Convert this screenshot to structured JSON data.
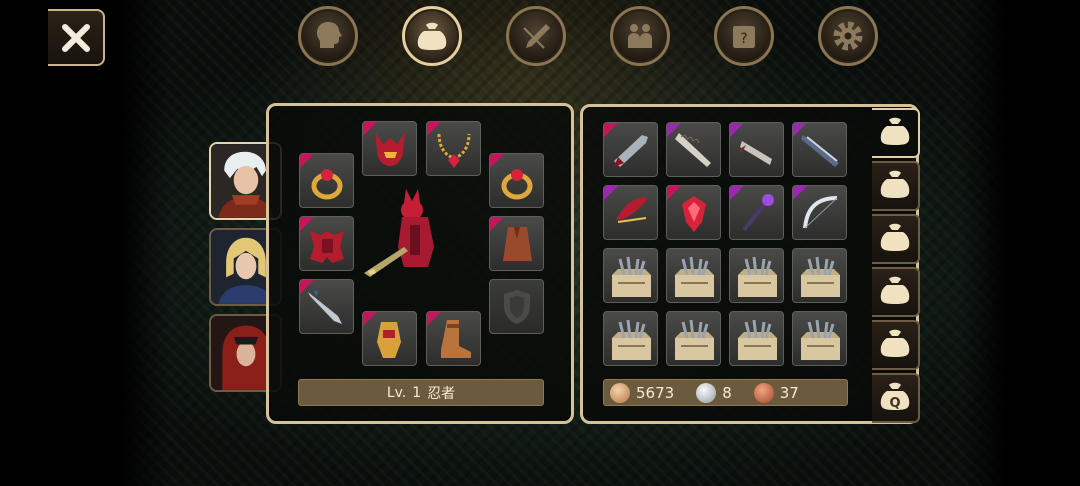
{
  "topnav": {
    "items": [
      {
        "name": "character",
        "icon": "head-silhouette-icon",
        "active": false
      },
      {
        "name": "inventory",
        "icon": "bag-icon",
        "active": true
      },
      {
        "name": "skills",
        "icon": "crossed-sword-icon",
        "active": false
      },
      {
        "name": "party",
        "icon": "party-people-icon",
        "active": false
      },
      {
        "name": "quests",
        "icon": "quest-scroll-icon",
        "active": false
      },
      {
        "name": "settings",
        "icon": "gear-icon",
        "active": false
      }
    ]
  },
  "characters": [
    {
      "portrait": "white-haired-ninja",
      "selected": true
    },
    {
      "portrait": "blonde-elf-knight",
      "selected": false
    },
    {
      "portrait": "red-haired-mage",
      "selected": false
    }
  ],
  "equipment": {
    "level_prefix": "Lv.",
    "level": "1",
    "class_name": "忍者",
    "slots": [
      {
        "slot": "helmet",
        "item": "red-dragon-helm",
        "rarity": "red"
      },
      {
        "slot": "necklace",
        "item": "gold-ruby-necklace",
        "rarity": "red"
      },
      {
        "slot": "ring-left",
        "item": "gold-ring",
        "rarity": "red"
      },
      {
        "slot": "ring-right",
        "item": "gold-ring",
        "rarity": "red"
      },
      {
        "slot": "armor",
        "item": "crimson-dragon-armor",
        "rarity": "red"
      },
      {
        "slot": "cloak",
        "item": "leather-cloak",
        "rarity": "red"
      },
      {
        "slot": "weapon",
        "item": "serrated-blade",
        "rarity": "red"
      },
      {
        "slot": "offhand",
        "item": "empty-shield",
        "rarity": "none"
      },
      {
        "slot": "gloves",
        "item": "gold-gauntlet",
        "rarity": "red"
      },
      {
        "slot": "boots",
        "item": "leather-boots",
        "rarity": "red"
      }
    ]
  },
  "inventory": {
    "items": [
      {
        "item": "red-blade",
        "rarity": "red"
      },
      {
        "item": "bone-saw-blade",
        "rarity": "purple"
      },
      {
        "item": "jagged-knife",
        "rarity": "purple"
      },
      {
        "item": "dark-greatsword",
        "rarity": "purple"
      },
      {
        "item": "red-wing-bow",
        "rarity": "purple"
      },
      {
        "item": "ruby-shield",
        "rarity": "red"
      },
      {
        "item": "purple-staff",
        "rarity": "purple"
      },
      {
        "item": "silver-bow",
        "rarity": "purple"
      },
      {
        "item": "weapon-crate",
        "rarity": "none"
      },
      {
        "item": "weapon-crate",
        "rarity": "none"
      },
      {
        "item": "weapon-crate",
        "rarity": "none"
      },
      {
        "item": "weapon-crate",
        "rarity": "none"
      },
      {
        "item": "weapon-crate",
        "rarity": "none"
      },
      {
        "item": "weapon-crate",
        "rarity": "none"
      },
      {
        "item": "weapon-crate",
        "rarity": "none"
      },
      {
        "item": "weapon-crate",
        "rarity": "none"
      }
    ],
    "currency": {
      "gold": "5673",
      "silver": "8",
      "copper": "37"
    }
  },
  "bag_tabs": [
    {
      "icon": "bag-icon",
      "label": "",
      "selected": true
    },
    {
      "icon": "bag-icon",
      "label": "",
      "selected": false
    },
    {
      "icon": "bag-icon",
      "label": "",
      "selected": false
    },
    {
      "icon": "bag-icon",
      "label": "",
      "selected": false
    },
    {
      "icon": "bag-icon",
      "label": "",
      "selected": false
    },
    {
      "icon": "quest-bag-icon",
      "label": "Q",
      "selected": false
    }
  ],
  "colors": {
    "rarity_red": "#c2185b",
    "rarity_purple": "#9c27b0",
    "frame": "#d6c29a",
    "label_bar": "#6c5a3e"
  }
}
